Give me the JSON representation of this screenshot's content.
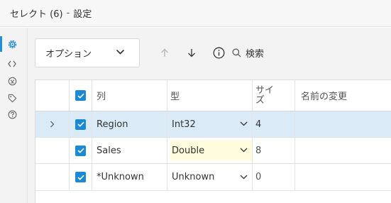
{
  "window": {
    "title": "セレクト (6)",
    "separator": "-",
    "subtitle": "設定"
  },
  "sidebar": {
    "tabs": [
      {
        "name": "settings",
        "icon": "gear-icon",
        "active": true
      },
      {
        "name": "code",
        "icon": "code-icon",
        "active": false
      },
      {
        "name": "transform",
        "icon": "target-icon",
        "active": false
      },
      {
        "name": "tags",
        "icon": "tag-icon",
        "active": false
      },
      {
        "name": "help",
        "icon": "help-icon",
        "active": false
      }
    ]
  },
  "toolbar": {
    "options_label": "オプション",
    "search_placeholder": "検索"
  },
  "table": {
    "headers": {
      "column": "列",
      "type": "型",
      "size_line1": "サイ",
      "size_line2": "ズ",
      "rename": "名前の変更"
    },
    "rows": [
      {
        "name": "Region",
        "type": "Int32",
        "size": "4",
        "rename": "",
        "checked": true,
        "selected": true,
        "editing": false
      },
      {
        "name": "Sales",
        "type": "Double",
        "size": "8",
        "rename": "",
        "checked": true,
        "selected": false,
        "editing": true
      },
      {
        "name": "*Unknown",
        "type": "Unknown",
        "size": "0",
        "rename": "",
        "checked": true,
        "selected": false,
        "editing": false
      }
    ]
  },
  "colors": {
    "accent": "#1a8ad4",
    "selected_row": "#daeaf7",
    "edit_cell": "#fffbdc"
  }
}
